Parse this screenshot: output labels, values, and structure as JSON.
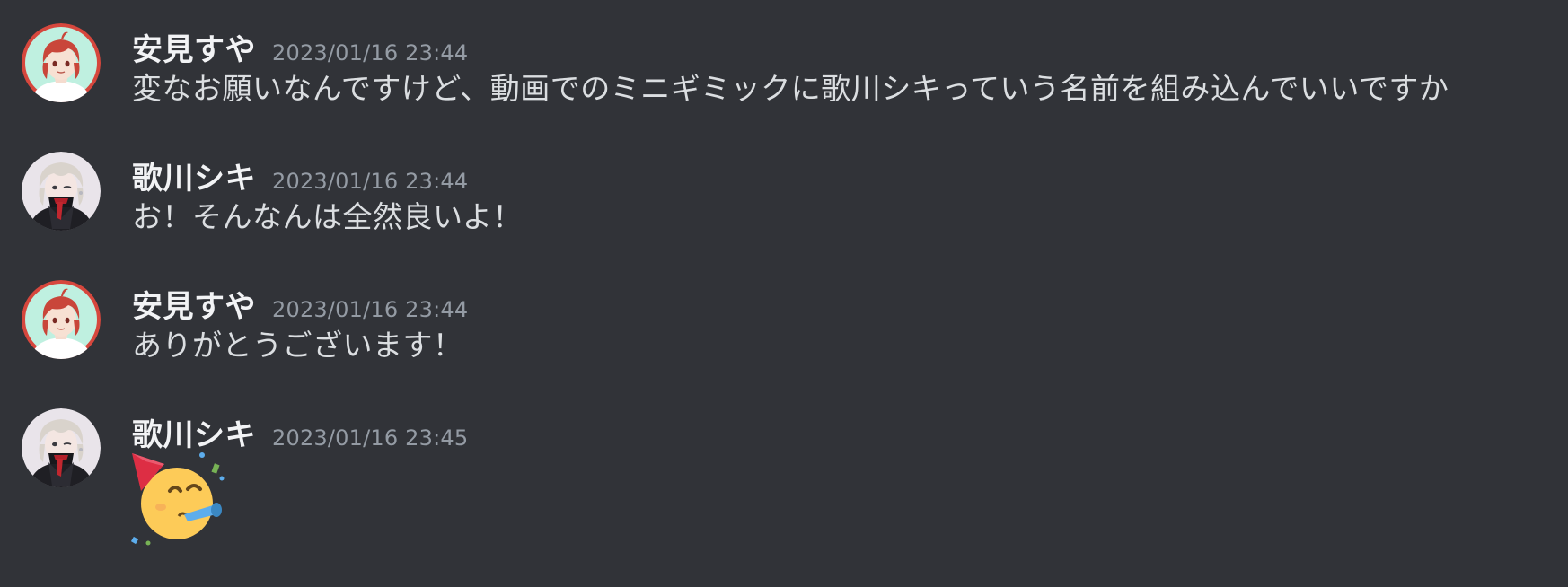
{
  "messages": [
    {
      "username": "安見すや",
      "timestamp": "2023/01/16 23:44",
      "content": "変なお願いなんですけど、動画でのミニギミックに歌川シキっていう名前を組み込んでいいですか",
      "avatar": "red-haired-avatar"
    },
    {
      "username": "歌川シキ",
      "timestamp": "2023/01/16 23:44",
      "content": "お！そんなんは全然良いよ！",
      "avatar": "silver-haired-avatar"
    },
    {
      "username": "安見すや",
      "timestamp": "2023/01/16 23:44",
      "content": "ありがとうございます！",
      "avatar": "red-haired-avatar"
    },
    {
      "username": "歌川シキ",
      "timestamp": "2023/01/16 23:45",
      "content_emoji": "partying-face-emoji",
      "avatar": "silver-haired-avatar"
    }
  ],
  "colors": {
    "background": "#313338",
    "username": "#f2f3f5",
    "timestamp": "#949ba4",
    "message_text": "#dbdee1"
  }
}
